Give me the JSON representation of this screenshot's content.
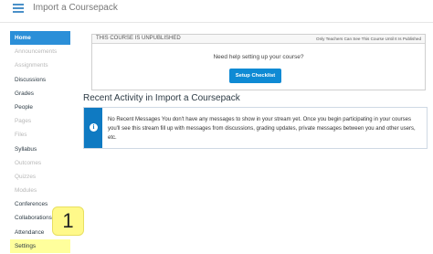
{
  "header": {
    "title": "Import a Coursepack"
  },
  "sidebar": {
    "items": [
      {
        "label": "Home",
        "state": "active"
      },
      {
        "label": "Announcements",
        "state": "disabled"
      },
      {
        "label": "Assignments",
        "state": "disabled"
      },
      {
        "label": "Discussions",
        "state": "normal"
      },
      {
        "label": "Grades",
        "state": "normal"
      },
      {
        "label": "People",
        "state": "normal"
      },
      {
        "label": "Pages",
        "state": "disabled"
      },
      {
        "label": "Files",
        "state": "disabled"
      },
      {
        "label": "Syllabus",
        "state": "normal"
      },
      {
        "label": "Outcomes",
        "state": "disabled"
      },
      {
        "label": "Quizzes",
        "state": "disabled"
      },
      {
        "label": "Modules",
        "state": "disabled"
      },
      {
        "label": "Conferences",
        "state": "normal"
      },
      {
        "label": "Collaborations",
        "state": "normal"
      },
      {
        "label": "Attendance",
        "state": "normal"
      },
      {
        "label": "Settings",
        "state": "highlight"
      }
    ]
  },
  "callout": {
    "number": "1"
  },
  "unpublished": {
    "banner": "THIS COURSE IS UNPUBLISHED",
    "note": "Only Teachers Can See This Course Until It Is Published",
    "help_text": "Need help setting up your course?",
    "button_label": "Setup Checklist"
  },
  "recent": {
    "heading": "Recent Activity in Import a Coursepack",
    "message": "No Recent Messages  You don't have any messages to show in your stream yet. Once you begin participating in your courses you'll see this stream fill up with messages from discussions, grading updates, private messages between you and other users, etc."
  },
  "colors": {
    "accent": "#2b8fd8",
    "highlight": "#ffff9c",
    "info": "#0f7ac2"
  }
}
